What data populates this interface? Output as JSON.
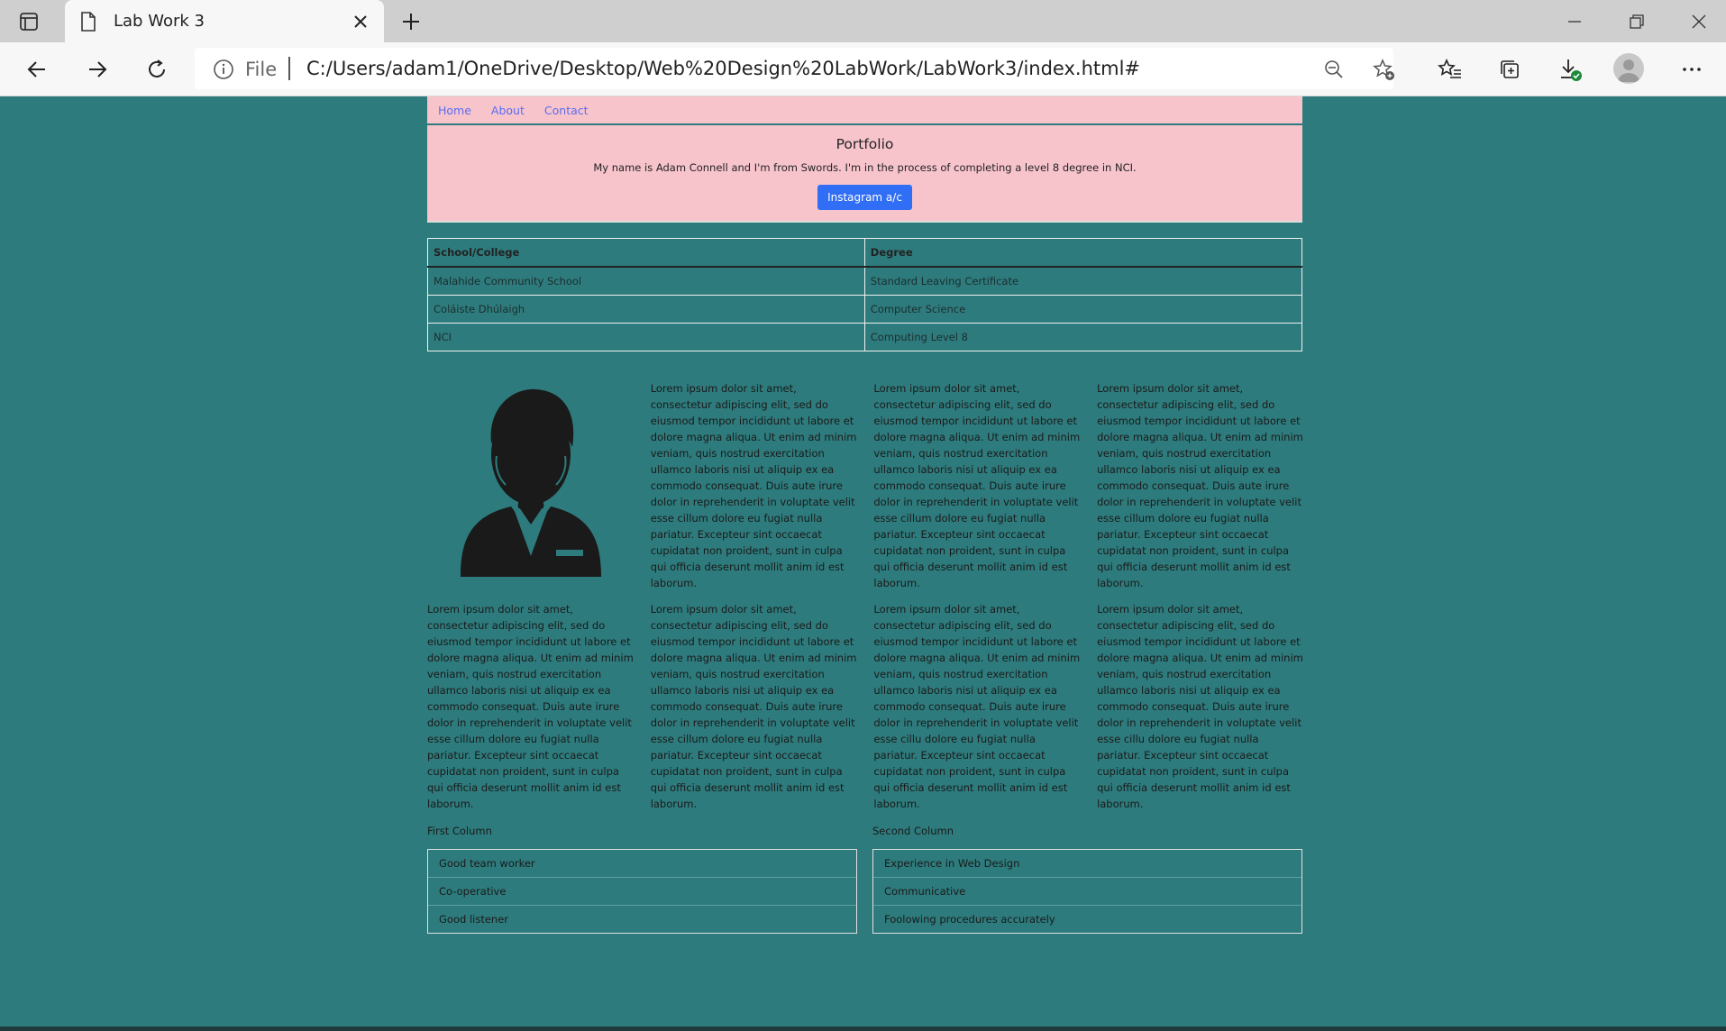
{
  "browser": {
    "tab_title": "Lab Work 3",
    "address_scheme": "File",
    "url": "C:/Users/adam1/OneDrive/Desktop/Web%20Design%20LabWork/LabWork3/index.html#"
  },
  "nav": {
    "items": [
      "Home",
      "About",
      "Contact"
    ]
  },
  "hero": {
    "title": "Portfolio",
    "text": "My name is Adam Connell and I'm from Swords. I'm in the process of completing a level 8 degree in NCI.",
    "button": "Instagram a/c"
  },
  "education": {
    "headers": [
      "School/College",
      "Degree"
    ],
    "rows": [
      [
        "Malahide Community School",
        "Standard Leaving Certificate"
      ],
      [
        "Coláiste Dhúlaigh",
        "Computer Science"
      ],
      [
        "NCI",
        "Computing Level 8"
      ]
    ]
  },
  "lorem": {
    "standard": "Lorem ipsum dolor sit amet, consectetur adipiscing elit, sed do eiusmod tempor incididunt ut labore et dolore magna aliqua. Ut enim ad minim veniam, quis nostrud exercitation ullamco laboris nisi ut aliquip ex ea commodo consequat. Duis aute irure dolor in reprehenderit in voluptate velit esse cillum dolore eu fugiat nulla pariatur. Excepteur sint occaecat cupidatat non proident, sunt in culpa qui officia deserunt mollit anim id est laborum.",
    "variant_cillu": "Lorem ipsum dolor sit amet, consectetur adipiscing elit, sed do eiusmod tempor incididunt ut labore et dolore magna aliqua. Ut enim ad minim veniam, quis nostrud exercitation ullamco laboris nisi ut aliquip ex ea commodo consequat. Duis aute irure dolor in reprehenderit in voluptate velit esse cillu dolore eu fugiat nulla pariatur. Excepteur sint occaecat cupidatat non proident, sunt in culpa qui officia deserunt mollit anim id est laborum."
  },
  "lists": {
    "first": {
      "title": "First Column",
      "items": [
        "Good team worker",
        "Co-operative",
        "Good listener"
      ]
    },
    "second": {
      "title": "Second Column",
      "items": [
        "Experience in Web Design",
        "Communicative",
        "Foolowing procedures accurately"
      ]
    }
  },
  "colors": {
    "page_bg": "#2e7b7d",
    "header_bg": "#f7c4cc",
    "button_bg": "#2f6ef5",
    "link": "#5a6cf0"
  },
  "icons": [
    "tab-actions-icon",
    "page-icon",
    "close-icon",
    "plus-icon",
    "minimize-icon",
    "restore-icon",
    "close-window-icon",
    "back-icon",
    "forward-icon",
    "refresh-icon",
    "info-icon",
    "zoom-out-icon",
    "add-favorite-icon",
    "favorites-icon",
    "collections-icon",
    "downloads-icon",
    "profile-icon",
    "more-icon",
    "person-avatar-icon"
  ]
}
